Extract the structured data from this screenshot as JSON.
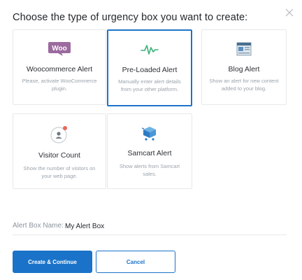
{
  "dialog": {
    "title": "Choose the type of urgency box you want to create:"
  },
  "cards": {
    "woocommerce": {
      "logo_text": "Woo",
      "title": "Woocommerce Alert",
      "description": "Please, activate WooCommerce plugin."
    },
    "preloaded": {
      "title": "Pre-Loaded Alert",
      "description": "Manually enter alert details from your other platform.",
      "selected": true
    },
    "blog": {
      "title": "Blog Alert",
      "description": "Show an alert for new content added to your blog."
    },
    "visitor": {
      "title": "Visitor Count",
      "description": "Show the number of visitors on your web page."
    },
    "samcart": {
      "title": "Samcart Alert",
      "description": "Show alerts from Samcart sales."
    }
  },
  "form": {
    "name_label": "Alert Box Name:",
    "name_value": "My Alert Box"
  },
  "actions": {
    "create_label": "Create & Continue",
    "cancel_label": "Cancel"
  },
  "colors": {
    "accent": "#1a73c9",
    "woo_purple": "#9b6a9f",
    "pulse_green": "#3bb27a",
    "notification_red": "#e8685a"
  },
  "icons": {
    "close": "close-icon",
    "woocommerce": "woocommerce-logo-icon",
    "preloaded": "pulse-icon",
    "blog": "blog-window-icon",
    "visitor": "user-notification-icon",
    "samcart": "cart-box-icon"
  }
}
